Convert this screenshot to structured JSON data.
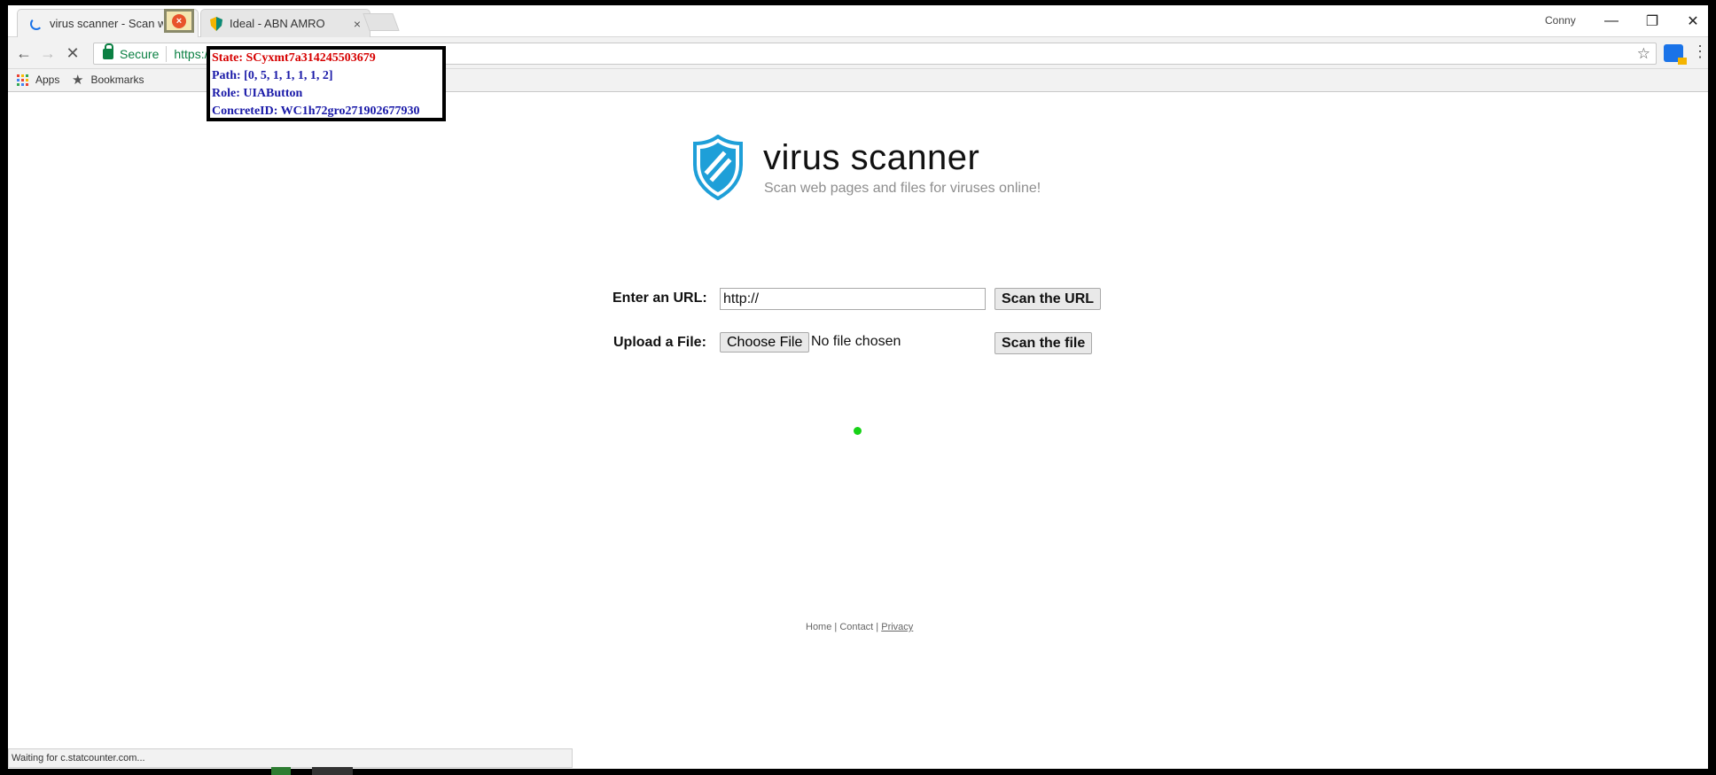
{
  "tabs": [
    {
      "title": "virus scanner - Scan web pages and files for viruses online!",
      "close": "×"
    },
    {
      "title": "Ideal - ABN AMRO",
      "close": "×"
    }
  ],
  "highlighted_close": "×",
  "profile_name": "Conny",
  "window_controls": {
    "minimize": "—",
    "restore": "❐",
    "close": "✕"
  },
  "toolbar": {
    "back": "←",
    "forward": "→",
    "reload": "✕",
    "secure_label": "Secure",
    "url": "https://",
    "star": "☆",
    "menu": "⋮"
  },
  "bookmarks": {
    "apps_label": "Apps",
    "bookmarks_label": "Bookmarks"
  },
  "inspector": {
    "state": "State: SCyxmt7a314245503679",
    "path": "Path: [0, 5, 1, 1, 1, 1, 2]",
    "role": "Role: UIAButton",
    "concrete_id": "ConcreteID: WC1h72gro271902677930"
  },
  "page": {
    "title": "virus scanner",
    "subtitle": "Scan web pages and files for viruses online!",
    "url_label": "Enter an URL:",
    "url_value": "http://",
    "scan_url_button": "Scan the URL",
    "file_label": "Upload a File:",
    "choose_file_button": "Choose File",
    "no_file_text": "No file chosen",
    "scan_file_button": "Scan the file"
  },
  "footer": {
    "home": "Home",
    "sep": " | ",
    "contact": "Contact",
    "privacy": "Privacy"
  },
  "status_text": "Waiting for c.statcounter.com...",
  "colors": {
    "accent_shield": "#1e9fd8",
    "secure_green": "#0b8043",
    "dot_green": "#18d218"
  }
}
